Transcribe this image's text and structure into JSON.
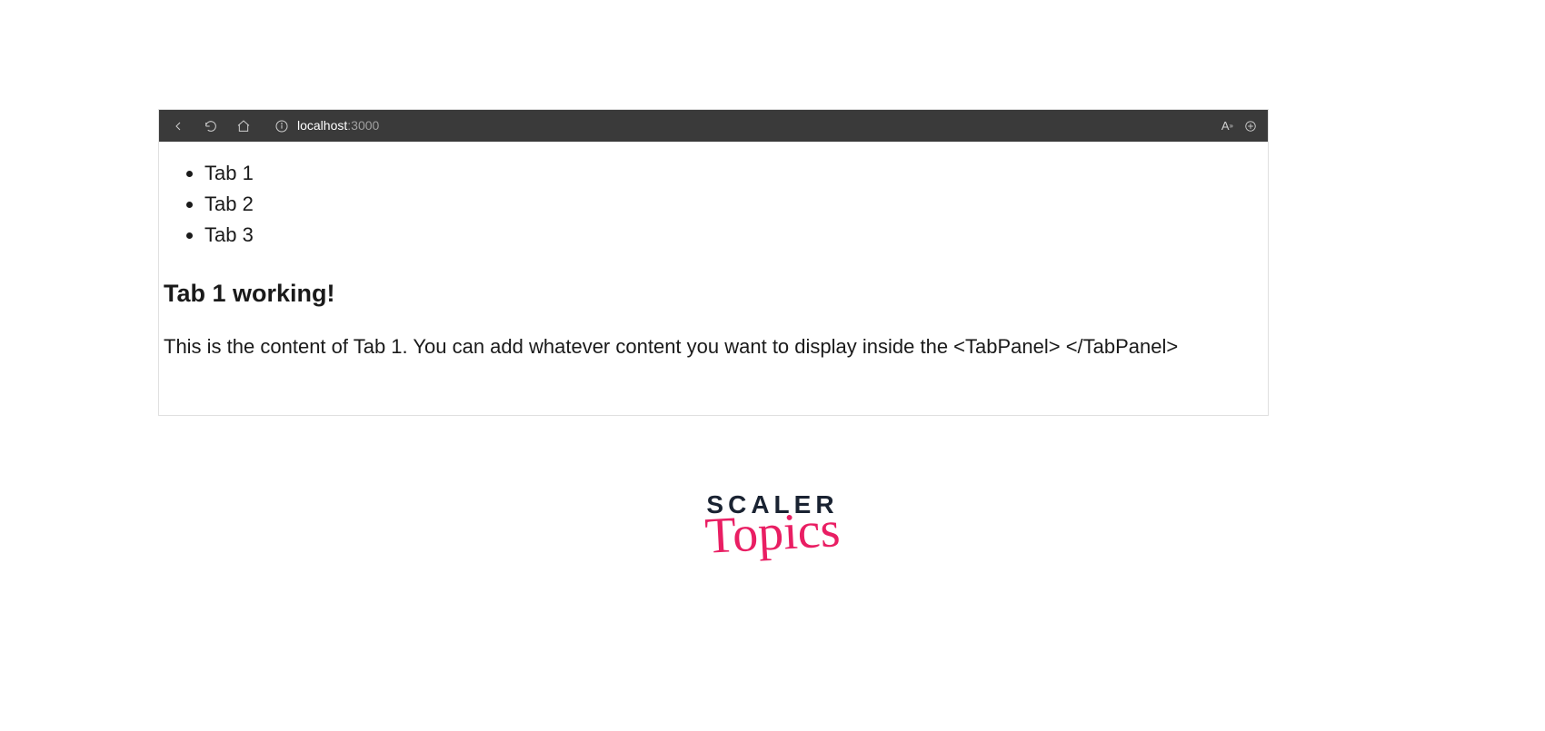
{
  "browser": {
    "url_host": "localhost",
    "url_port": ":3000"
  },
  "page": {
    "tabs": [
      {
        "label": "Tab 1"
      },
      {
        "label": "Tab 2"
      },
      {
        "label": "Tab 3"
      }
    ],
    "heading": "Tab 1 working!",
    "content_text": "This is the content of Tab 1. You can add whatever content you want to display inside the <TabPanel> </TabPanel>"
  },
  "logo": {
    "line1": "SCALER",
    "line2": "Topics"
  }
}
